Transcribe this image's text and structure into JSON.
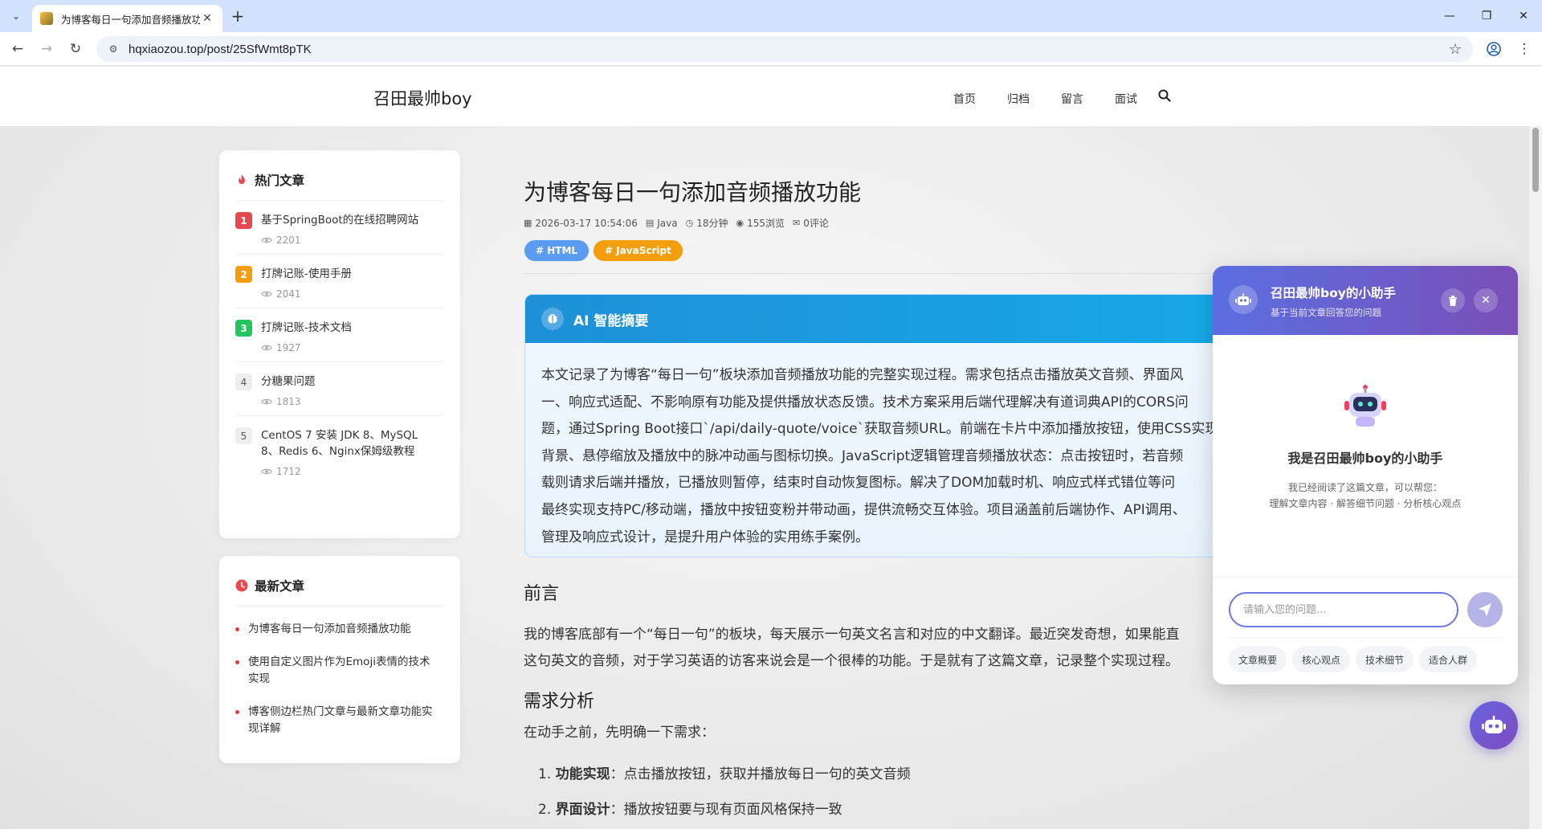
{
  "browser": {
    "tab_title": "为博客每日一句添加音频播放功能",
    "url": "hqxiaozou.top/post/25SfWmt8pTK"
  },
  "site": {
    "brand": "召田最帅boy",
    "nav": [
      "首页",
      "归档",
      "留言",
      "面试"
    ]
  },
  "sidebar": {
    "hot_title": "热门文章",
    "hot": [
      {
        "rank": "1",
        "title": "基于SpringBoot的在线招聘网站",
        "views": "2201",
        "color": "#e5484d"
      },
      {
        "rank": "2",
        "title": "打牌记账-使用手册",
        "views": "2041",
        "color": "#f59e0b"
      },
      {
        "rank": "3",
        "title": "打牌记账-技术文档",
        "views": "1927",
        "color": "#22c55e"
      },
      {
        "rank": "4",
        "title": "分糖果问题",
        "views": "1813",
        "color": "#eeeeee"
      },
      {
        "rank": "5",
        "title": "CentOS 7 安装 JDK 8、MySQL 8、Redis 6、Nginx保姆级教程",
        "views": "1712",
        "color": "#eeeeee"
      }
    ],
    "new_title": "最新文章",
    "new": [
      "为博客每日一句添加音频播放功能",
      "使用自定义图片作为Emoji表情的技术实现",
      "博客侧边栏热门文章与最新文章功能实现详解"
    ]
  },
  "article": {
    "title": "为博客每日一句添加音频播放功能",
    "meta": {
      "date": "2026-03-17 10:54:06",
      "category": "Java",
      "read_time": "18分钟",
      "views": "155浏览",
      "comments": "0评论"
    },
    "tags": [
      {
        "label": "# HTML",
        "color": "#5b9cf3"
      },
      {
        "label": "# JavaScript",
        "color": "#f59e0b"
      }
    ],
    "ai_title": "AI 智能摘要",
    "ai_lines": [
      "本文记录了为博客“每日一句”板块添加音频播放功能的完整实现过程。需求包括点击播放英文音频、界面风",
      "一、响应式适配、不影响原有功能及提供播放状态反馈。技术方案采用后端代理解决有道词典API的CORS问",
      "题，通过Spring Boot接口`/api/daily-quote/voice`获取音频URL。前端在卡片中添加播放按钮，使用CSS实现",
      "背景、悬停缩放及播放中的脉冲动画与图标切换。JavaScript逻辑管理音频播放状态：点击按钮时，若音频",
      "载则请求后端并播放，已播放则暂停，结束时自动恢复图标。解决了DOM加载时机、响应式样式错位等问",
      "最终实现支持PC/移动端，播放中按钮变粉并带动画，提供流畅交互体验。项目涵盖前后端协作、API调用、",
      "管理及响应式设计，是提升用户体验的实用练手案例。"
    ],
    "h_preface": "前言",
    "preface_lines": [
      "我的博客底部有一个“每日一句”的板块，每天展示一句英文名言和对应的中文翻译。最近突发奇想，如果能直",
      "这句英文的音频，对于学习英语的访客来说会是一个很棒的功能。于是就有了这篇文章，记录整个实现过程。"
    ],
    "h_req": "需求分析",
    "req_intro": "在动手之前，先明确一下需求：",
    "req_items": [
      {
        "num": "1.",
        "bold": "功能实现",
        "text": "：点击播放按钮，获取并播放每日一句的英文音频"
      },
      {
        "num": "2.",
        "bold": "界面设计",
        "text": "：播放按钮要与现有页面风格保持一致"
      }
    ]
  },
  "chat": {
    "title": "召田最帅boy的小助手",
    "subtitle": "基于当前文章回答您的问题",
    "welcome": "我是召田最帅boy的小助手",
    "desc_line1": "我已经阅读了这篇文章，可以帮您：",
    "desc_line2": "理解文章内容 · 解答细节问题 · 分析核心观点",
    "input_placeholder": "请输入您的问题...",
    "chips": [
      "文章概要",
      "核心观点",
      "技术细节",
      "适合人群"
    ]
  },
  "colors": {
    "accent_blue": "#17a8e8",
    "chat_purple": "#6a63df",
    "hot_red": "#e5484d"
  }
}
